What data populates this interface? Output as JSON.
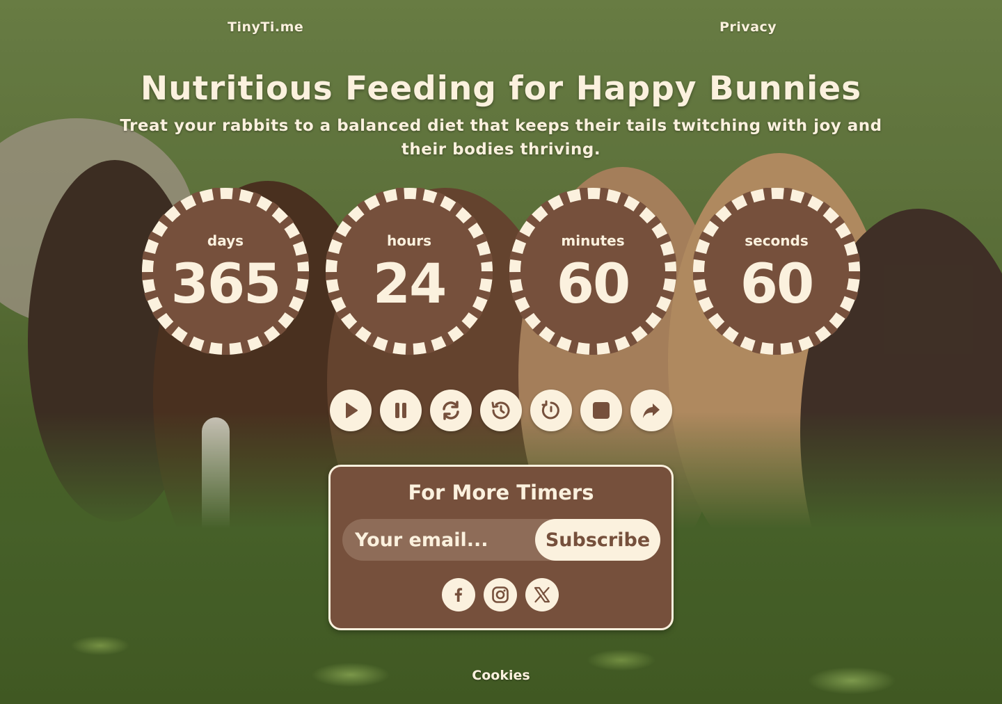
{
  "header": {
    "brand": "TinyTi.me",
    "privacy": "Privacy"
  },
  "hero": {
    "title": "Nutritious Feeding for Happy Bunnies",
    "subtitle": "Treat your rabbits to a balanced diet that keeps their tails twitching with joy and their bodies thriving."
  },
  "timer": {
    "units": [
      {
        "label": "days",
        "value": "365"
      },
      {
        "label": "hours",
        "value": "24"
      },
      {
        "label": "minutes",
        "value": "60"
      },
      {
        "label": "seconds",
        "value": "60"
      }
    ]
  },
  "controls": [
    "play-icon",
    "pause-icon",
    "refresh-icon",
    "history-icon",
    "timer-reset-icon",
    "stop-icon",
    "share-icon"
  ],
  "subscribe": {
    "title": "For More Timers",
    "email_placeholder": "Your email...",
    "button": "Subscribe"
  },
  "socials": [
    "facebook-icon",
    "instagram-icon",
    "x-icon"
  ],
  "footer": {
    "cookies": "Cookies"
  },
  "colors": {
    "cream": "#fbf1de",
    "brown": "#76503c"
  }
}
